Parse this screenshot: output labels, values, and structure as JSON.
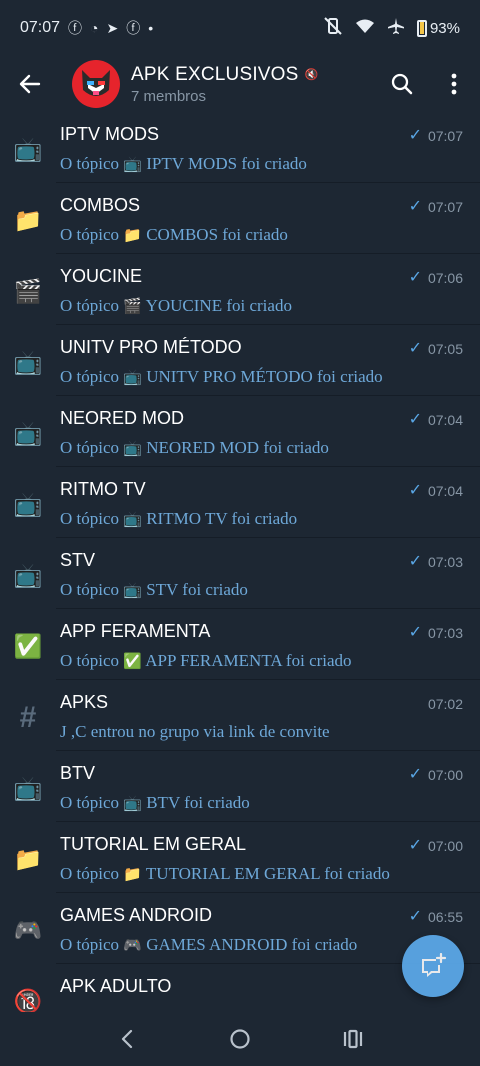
{
  "status_bar": {
    "time": "07:07",
    "battery": "93%"
  },
  "header": {
    "title": "APK EXCLUSIVOS",
    "subtitle": "7 membros"
  },
  "topics": [
    {
      "icon": "📺",
      "name": "IPTV MODS",
      "prefix": "O tópico",
      "msg_icon": "📺",
      "msg": "IPTV MODS foi criado",
      "time": "07:07",
      "read": true
    },
    {
      "icon": "📁",
      "name": "COMBOS",
      "prefix": "O tópico",
      "msg_icon": "📁",
      "msg": "COMBOS foi criado",
      "time": "07:07",
      "read": true
    },
    {
      "icon": "🎬",
      "name": "YOUCINE",
      "prefix": "O tópico",
      "msg_icon": "🎬",
      "msg": "YOUCINE foi criado",
      "time": "07:06",
      "read": true
    },
    {
      "icon": "📺",
      "name": "UNITV PRO MÉTODO",
      "prefix": "O tópico",
      "msg_icon": "📺",
      "msg": "UNITV PRO MÉTODO foi criado",
      "time": "07:05",
      "read": true
    },
    {
      "icon": "📺",
      "name": "NEORED MOD",
      "prefix": "O tópico",
      "msg_icon": "📺",
      "msg": "NEORED MOD foi criado",
      "time": "07:04",
      "read": true
    },
    {
      "icon": "📺",
      "name": "RITMO TV",
      "prefix": "O tópico",
      "msg_icon": "📺",
      "msg": "RITMO TV foi criado",
      "time": "07:04",
      "read": true
    },
    {
      "icon": "📺",
      "name": "STV",
      "prefix": "O tópico",
      "msg_icon": "📺",
      "msg": "STV foi criado",
      "time": "07:03",
      "read": true
    },
    {
      "icon": "✅",
      "name": "APP FERAMENTA",
      "prefix": "O tópico",
      "msg_icon": "✅",
      "msg": "APP FERAMENTA foi criado",
      "time": "07:03",
      "read": true
    },
    {
      "icon": "#",
      "name": "APKS",
      "prefix": "",
      "msg_icon": "",
      "msg": "J ,C entrou no grupo via link de convite",
      "time": "07:02",
      "read": false
    },
    {
      "icon": "📺",
      "name": "BTV",
      "prefix": "O tópico",
      "msg_icon": "📺",
      "msg": "BTV foi criado",
      "time": "07:00",
      "read": true
    },
    {
      "icon": "📁",
      "name": "TUTORIAL EM GERAL",
      "prefix": "O tópico",
      "msg_icon": "📁",
      "msg": "TUTORIAL EM GERAL foi criado",
      "time": "07:00",
      "read": true
    },
    {
      "icon": "🎮",
      "name": "GAMES ANDROID",
      "prefix": "O tópico",
      "msg_icon": "🎮",
      "msg": "GAMES ANDROID foi criado",
      "time": "06:55",
      "read": true
    },
    {
      "icon": "🔞",
      "name": "APK ADULTO",
      "prefix": "",
      "msg_icon": "",
      "msg": "",
      "time": "",
      "read": true
    }
  ]
}
